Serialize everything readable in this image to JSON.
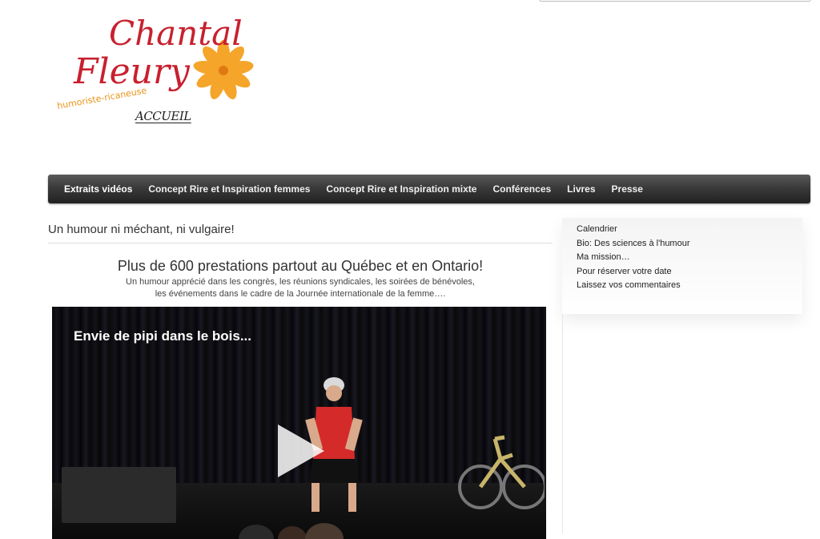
{
  "brand": {
    "name_line1": "Chantal",
    "name_line2": "Fleury",
    "tagline": "humoriste-ricaneuse",
    "home_link": "ACCUEIL",
    "primary_color": "#c8202f",
    "flower_color": "#f4a52a"
  },
  "nav": {
    "items": [
      {
        "label": "Extraits vidéos"
      },
      {
        "label": "Concept Rire et Inspiration femmes"
      },
      {
        "label": "Concept Rire et Inspiration mixte"
      },
      {
        "label": "Conférences"
      },
      {
        "label": "Livres"
      },
      {
        "label": "Presse"
      }
    ]
  },
  "main": {
    "title": "Un humour ni méchant, ni vulgaire!",
    "headline": "Plus de 600 prestations partout au Québec et en Ontario!",
    "subtext_line1": "Un humour apprécié dans les congrès, les réunions syndicales, les soirées de bénévoles,",
    "subtext_line2": "les événements dans le cadre de la Journée internationale de la femme…."
  },
  "video": {
    "title": "Envie de pipi dans le bois...",
    "play_icon": "play-icon"
  },
  "sidebar": {
    "links": [
      {
        "label": "Calendrier"
      },
      {
        "label": "Bio: Des sciences à l'humour"
      },
      {
        "label": "Ma mission…"
      },
      {
        "label": "Pour réserver votre date"
      },
      {
        "label": "Laissez vos commentaires"
      }
    ]
  }
}
